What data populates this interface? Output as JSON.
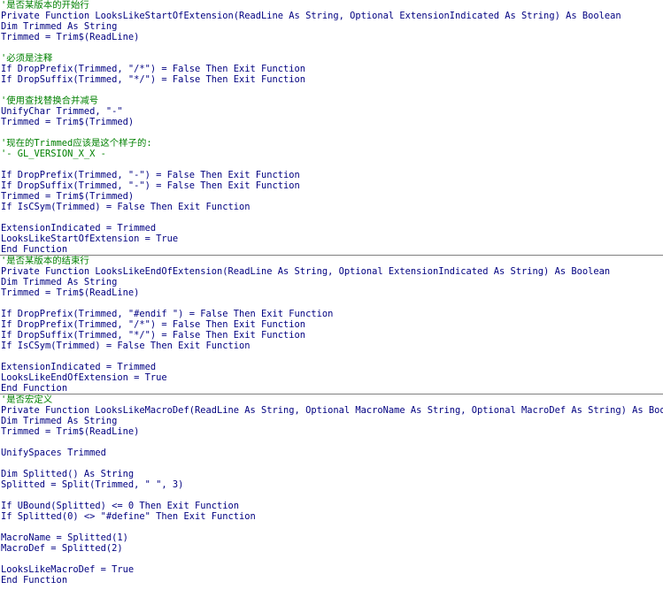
{
  "editor": {
    "procedures": [
      {
        "name": "LooksLikeStartOfExtension",
        "lines": [
          {
            "text": "'是否某版本的开始行",
            "type": "comment"
          },
          {
            "text": "Private Function LooksLikeStartOfExtension(ReadLine As String, Optional ExtensionIndicated As String) As Boolean",
            "type": "code"
          },
          {
            "text": "Dim Trimmed As String",
            "type": "code"
          },
          {
            "text": "Trimmed = Trim$(ReadLine)",
            "type": "code"
          },
          {
            "text": "",
            "type": "blank"
          },
          {
            "text": "'必须是注释",
            "type": "comment"
          },
          {
            "text": "If DropPrefix(Trimmed, \"/*\") = False Then Exit Function",
            "type": "code"
          },
          {
            "text": "If DropSuffix(Trimmed, \"*/\") = False Then Exit Function",
            "type": "code"
          },
          {
            "text": "",
            "type": "blank"
          },
          {
            "text": "'使用查找替换合并减号",
            "type": "comment"
          },
          {
            "text": "UnifyChar Trimmed, \"-\"",
            "type": "code"
          },
          {
            "text": "Trimmed = Trim$(Trimmed)",
            "type": "code"
          },
          {
            "text": "",
            "type": "blank"
          },
          {
            "text": "'现在的Trimmed应该是这个样子的:",
            "type": "comment"
          },
          {
            "text": "'- GL_VERSION_X_X -",
            "type": "comment"
          },
          {
            "text": "",
            "type": "blank"
          },
          {
            "text": "If DropPrefix(Trimmed, \"-\") = False Then Exit Function",
            "type": "code"
          },
          {
            "text": "If DropSuffix(Trimmed, \"-\") = False Then Exit Function",
            "type": "code"
          },
          {
            "text": "Trimmed = Trim$(Trimmed)",
            "type": "code"
          },
          {
            "text": "If IsCSym(Trimmed) = False Then Exit Function",
            "type": "code"
          },
          {
            "text": "",
            "type": "blank"
          },
          {
            "text": "ExtensionIndicated = Trimmed",
            "type": "code"
          },
          {
            "text": "LooksLikeStartOfExtension = True",
            "type": "code"
          },
          {
            "text": "End Function",
            "type": "code"
          }
        ]
      },
      {
        "name": "LooksLikeEndOfExtension",
        "lines": [
          {
            "text": "'是否某版本的结束行",
            "type": "comment"
          },
          {
            "text": "Private Function LooksLikeEndOfExtension(ReadLine As String, Optional ExtensionIndicated As String) As Boolean",
            "type": "code"
          },
          {
            "text": "Dim Trimmed As String",
            "type": "code"
          },
          {
            "text": "Trimmed = Trim$(ReadLine)",
            "type": "code"
          },
          {
            "text": "",
            "type": "blank"
          },
          {
            "text": "If DropPrefix(Trimmed, \"#endif \") = False Then Exit Function",
            "type": "code"
          },
          {
            "text": "If DropPrefix(Trimmed, \"/*\") = False Then Exit Function",
            "type": "code"
          },
          {
            "text": "If DropSuffix(Trimmed, \"*/\") = False Then Exit Function",
            "type": "code"
          },
          {
            "text": "If IsCSym(Trimmed) = False Then Exit Function",
            "type": "code"
          },
          {
            "text": "",
            "type": "blank"
          },
          {
            "text": "ExtensionIndicated = Trimmed",
            "type": "code"
          },
          {
            "text": "LooksLikeEndOfExtension = True",
            "type": "code"
          },
          {
            "text": "End Function",
            "type": "code"
          }
        ]
      },
      {
        "name": "LooksLikeMacroDef",
        "lines": [
          {
            "text": "'是否宏定义",
            "type": "comment"
          },
          {
            "text": "Private Function LooksLikeMacroDef(ReadLine As String, Optional MacroName As String, Optional MacroDef As String) As Boolean",
            "type": "code"
          },
          {
            "text": "Dim Trimmed As String",
            "type": "code"
          },
          {
            "text": "Trimmed = Trim$(ReadLine)",
            "type": "code"
          },
          {
            "text": "",
            "type": "blank"
          },
          {
            "text": "UnifySpaces Trimmed",
            "type": "code"
          },
          {
            "text": "",
            "type": "blank"
          },
          {
            "text": "Dim Splitted() As String",
            "type": "code"
          },
          {
            "text": "Splitted = Split(Trimmed, \" \", 3)",
            "type": "code"
          },
          {
            "text": "",
            "type": "blank"
          },
          {
            "text": "If UBound(Splitted) <= 0 Then Exit Function",
            "type": "code"
          },
          {
            "text": "If Splitted(0) <> \"#define\" Then Exit Function",
            "type": "code"
          },
          {
            "text": "",
            "type": "blank"
          },
          {
            "text": "MacroName = Splitted(1)",
            "type": "code"
          },
          {
            "text": "MacroDef = Splitted(2)",
            "type": "code"
          },
          {
            "text": "",
            "type": "blank"
          },
          {
            "text": "LooksLikeMacroDef = True",
            "type": "code"
          },
          {
            "text": "End Function",
            "type": "code"
          }
        ]
      }
    ]
  }
}
